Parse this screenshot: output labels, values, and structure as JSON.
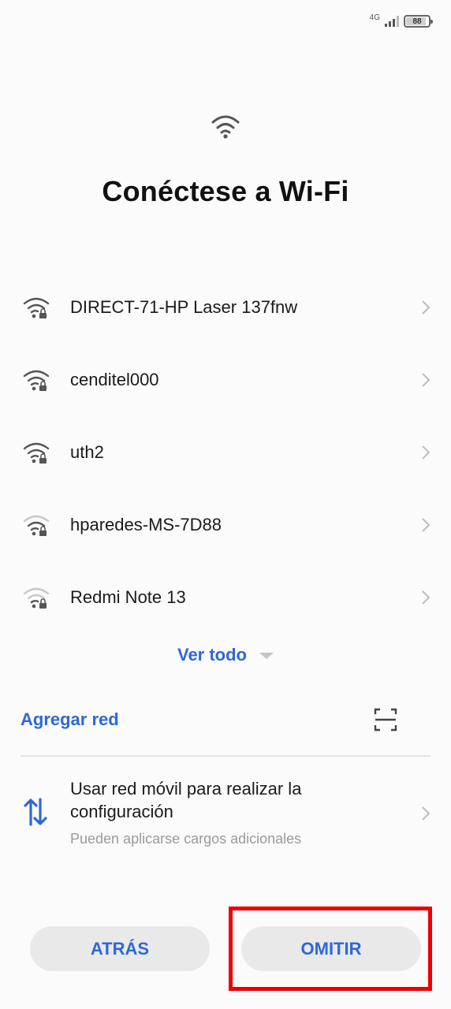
{
  "status_bar": {
    "network_type": "4G",
    "signal_level": 3,
    "battery_percent": "88"
  },
  "header": {
    "title": "Conéctese a Wi-Fi"
  },
  "networks": [
    {
      "ssid": "DIRECT-71-HP Laser 137fnw",
      "locked": true,
      "signal_level": 3
    },
    {
      "ssid": "cenditel000",
      "locked": true,
      "signal_level": 3
    },
    {
      "ssid": "uth2",
      "locked": true,
      "signal_level": 3
    },
    {
      "ssid": "hparedes-MS-7D88",
      "locked": true,
      "signal_level": 2
    },
    {
      "ssid": "Redmi Note 13",
      "locked": true,
      "signal_level": 1
    }
  ],
  "see_all": {
    "label": "Ver todo"
  },
  "add_network": {
    "label": "Agregar red",
    "scan_icon": "qr-scan-icon"
  },
  "mobile_data": {
    "title": "Usar red móvil para realizar la configuración",
    "subtitle": "Pueden aplicarse cargos adicionales",
    "icon": "data-transfer-icon"
  },
  "buttons": {
    "back": "ATRÁS",
    "skip": "OMITIR"
  },
  "colors": {
    "accent": "#2f67d8",
    "highlight": "#ee0000",
    "background": "#fbfbfb"
  }
}
